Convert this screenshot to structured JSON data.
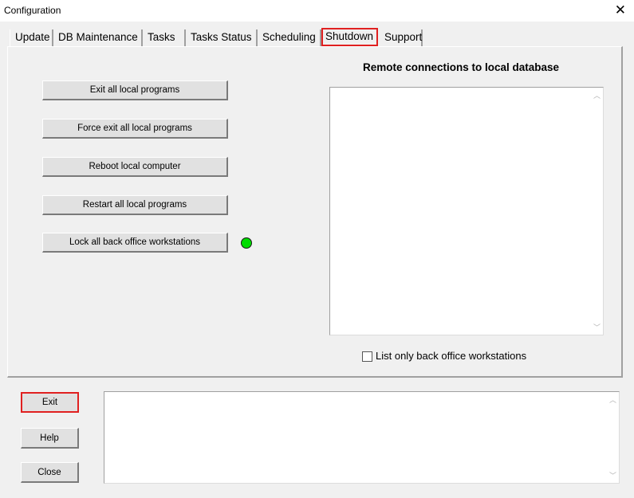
{
  "window": {
    "title": "Configuration",
    "close_glyph": "✕"
  },
  "tabs": [
    {
      "label": "Update"
    },
    {
      "label": "DB Maintenance"
    },
    {
      "label": "Tasks"
    },
    {
      "label": "Tasks Status"
    },
    {
      "label": "Scheduling"
    },
    {
      "label": "Shutdown"
    },
    {
      "label": "Support"
    }
  ],
  "active_tab": "Shutdown",
  "shutdown": {
    "buttons": [
      {
        "label": "Exit all local programs"
      },
      {
        "label": "Force exit all local programs"
      },
      {
        "label": "Reboot local computer"
      },
      {
        "label": "Restart all local programs"
      },
      {
        "label": "Lock all back office workstations"
      }
    ],
    "status_led_color": "#00dd00",
    "remote_heading": "Remote connections to local database",
    "remote_connections": [],
    "checkbox_label": "List only back office workstations",
    "checkbox_checked": false
  },
  "footer": {
    "exit_label": "Exit",
    "help_label": "Help",
    "close_label": "Close",
    "log_text": ""
  },
  "colors": {
    "highlight": "#e02020",
    "background": "#f0f0f0"
  }
}
